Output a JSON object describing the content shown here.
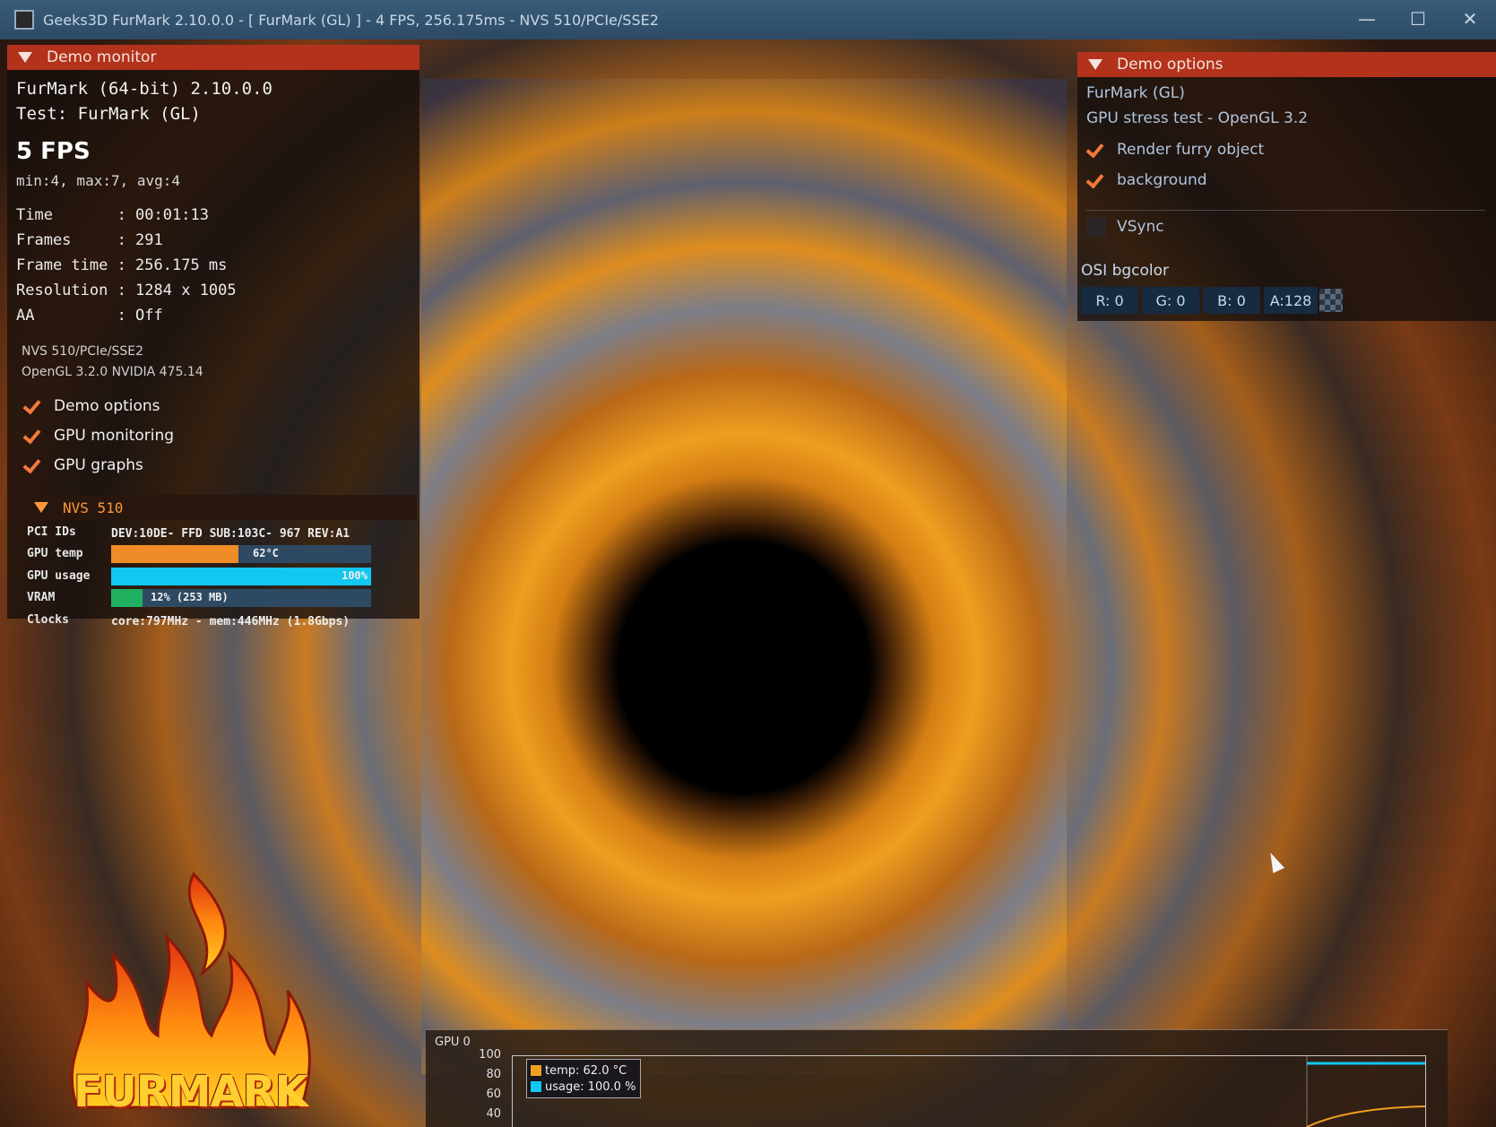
{
  "window": {
    "title": "Geeks3D FurMark 2.10.0.0 - [ FurMark (GL) ] - 4 FPS, 256.175ms - NVS 510/PCIe/SSE2",
    "minimize": "—",
    "maximize": "☐",
    "close": "✕"
  },
  "demo_monitor": {
    "header": "Demo monitor",
    "app_line": "FurMark (64-bit) 2.10.0.0",
    "test_line": "Test: FurMark (GL)",
    "fps": "5 FPS",
    "fps_stats": "min:4, max:7, avg:4",
    "stats": [
      "Time       : 00:01:13",
      "Frames     : 291",
      "Frame time : 256.175 ms",
      "Resolution : 1284 x 1005",
      "AA         : Off"
    ],
    "renderer": "NVS 510/PCIe/SSE2",
    "gl_version": "OpenGL 3.2.0 NVIDIA 475.14",
    "checks": [
      "Demo options",
      "GPU monitoring",
      "GPU graphs"
    ]
  },
  "gpu": {
    "header": "NVS 510",
    "pci_label": "PCI IDs",
    "pci_value": "DEV:10DE- FFD SUB:103C- 967 REV:A1",
    "temp_label": "GPU temp",
    "temp_value": "62°C",
    "temp_fraction": 0.49,
    "usage_label": "GPU usage",
    "usage_value": "100%",
    "usage_fraction": 1.0,
    "vram_label": "VRAM",
    "vram_value": "12% (253 MB)",
    "vram_fraction": 0.12,
    "clocks_label": "Clocks",
    "clocks_value": "core:797MHz - mem:446MHz (1.8Gbps)",
    "colors": {
      "temp": "#f08c28",
      "usage": "#10c8f0",
      "vram": "#20b060",
      "bar_bg": "#2e4a62"
    }
  },
  "demo_options": {
    "header": "Demo options",
    "line1": "FurMark (GL)",
    "line2": "GPU stress test - OpenGL 3.2",
    "render_furry": "Render furry object",
    "background": "background",
    "vsync": "VSync",
    "osi_label": "OSI bgcolor",
    "r": "R: 0",
    "g": "G: 0",
    "b": "B: 0",
    "a": "A:128"
  },
  "graph": {
    "title": "GPU 0",
    "yticks": [
      "100",
      "80",
      "60",
      "40"
    ],
    "legend_temp": "temp: 62.0 °C",
    "legend_usage": "usage: 100.0 %",
    "colors": {
      "temp": "#f0a020",
      "usage": "#10c8f0"
    }
  },
  "logo": {
    "text": "FURMARK",
    "icon": "flames-icon"
  }
}
